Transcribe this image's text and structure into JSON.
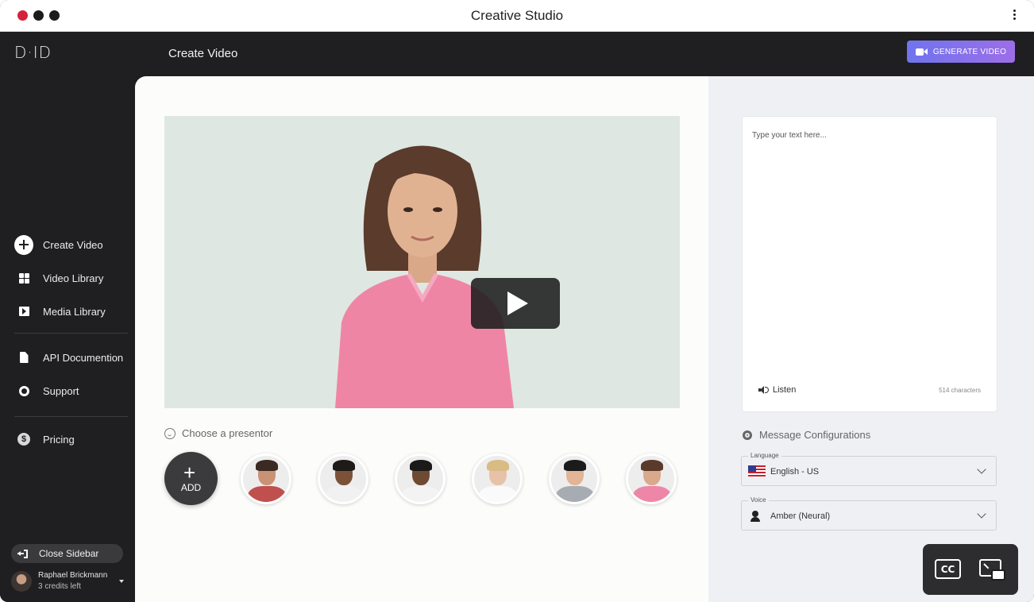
{
  "window": {
    "title": "Creative Studio"
  },
  "app": {
    "logo": "D·ID",
    "page_title": "Create Video",
    "generate_button": "GENERATE VIDEO"
  },
  "sidebar": {
    "items": [
      {
        "label": "Create Video",
        "icon": "plus-circle-icon"
      },
      {
        "label": "Video Library",
        "icon": "grid-icon"
      },
      {
        "label": "Media Library",
        "icon": "media-play-icon"
      },
      {
        "label": "API Documention",
        "icon": "document-icon"
      },
      {
        "label": "Support",
        "icon": "lifebuoy-icon"
      },
      {
        "label": "Pricing",
        "icon": "dollar-icon"
      }
    ],
    "close_label": "Close Sidebar",
    "user": {
      "name": "Raphael Brickmann",
      "credits": "3 credits left"
    }
  },
  "main": {
    "presenter_heading": "Choose a presentor",
    "add_label": "ADD",
    "add_symbol": "+",
    "presenters": [
      {
        "name": "man-plaid-shirt",
        "skin": "#c99275",
        "shirt": "#c0504d",
        "hair": "#3a2a22"
      },
      {
        "name": "man-curly-hair",
        "skin": "#7b5238",
        "shirt": "#f1f1f1",
        "hair": "#1e1a18"
      },
      {
        "name": "man-glasses",
        "skin": "#6f4a33",
        "shirt": "#f3f3f3",
        "hair": "#1a1a1a"
      },
      {
        "name": "woman-blonde",
        "skin": "#e8c2a8",
        "shirt": "#fafafa",
        "hair": "#d9bb84"
      },
      {
        "name": "man-grey-sweater",
        "skin": "#e1b595",
        "shirt": "#a7acb3",
        "hair": "#1b1b1b"
      },
      {
        "name": "woman-pink-shirt",
        "skin": "#d8a98a",
        "shirt": "#ee86a7",
        "hair": "#5a3a2a"
      }
    ]
  },
  "script_panel": {
    "placeholder": "Type your text here...",
    "listen_label": "Listen",
    "char_count": "514 characters",
    "config_heading": "Message Configurations",
    "language": {
      "label": "Language",
      "value": "English - US"
    },
    "voice": {
      "label": "Voice",
      "value": "Amber (Neural)"
    }
  },
  "overlay": {
    "cc_label": "CC"
  },
  "colors": {
    "accent_start": "#6f74ee",
    "accent_end": "#9d6ee8",
    "sidebar_bg": "#1f1f21"
  }
}
